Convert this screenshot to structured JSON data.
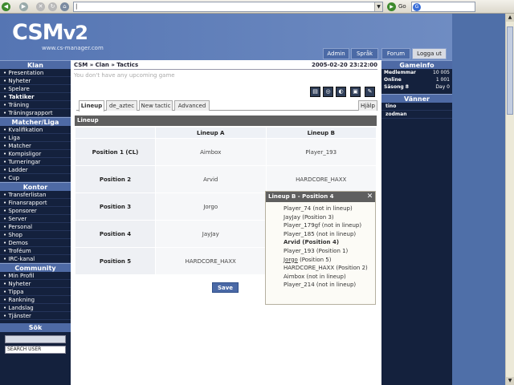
{
  "browser": {
    "url": "|",
    "go_label": "Go"
  },
  "logo": {
    "main": "CSM",
    "version": "v2",
    "sub": "www.cs-manager.com"
  },
  "topnav": [
    "Admin",
    "Språk",
    "Forum",
    "Logga ut"
  ],
  "leftnav": {
    "sections": [
      {
        "title": "Klan",
        "items": [
          "Presentation",
          "Nyheter",
          "Spelare",
          "Taktiker",
          "Träning",
          "Träningsrapport"
        ]
      },
      {
        "title": "Matcher/Liga",
        "items": [
          "Kvalifikation",
          "Liga",
          "Matcher",
          "Kompisligor",
          "Turneringar",
          "Ladder",
          "Cup"
        ]
      },
      {
        "title": "Kontor",
        "items": [
          "Transferlistan",
          "Finansrapport",
          "Sponsorer",
          "Server",
          "Personal",
          "Shop",
          "Demos",
          "Troféum",
          "IRC-kanal"
        ]
      },
      {
        "title": "Community",
        "items": [
          "Min Profil",
          "Nyheter",
          "Tippa",
          "Rankning",
          "Landslag",
          "Tjänster"
        ]
      }
    ],
    "active_item": "Taktiker",
    "search_title": "Sök",
    "search_select": "SEARCH USER"
  },
  "main": {
    "breadcrumb": "CSM » Clan » Tactics",
    "datetime": "2005-02-20 23:22:00",
    "notice": "You don't have any upcoming game",
    "tabs": [
      "Lineup",
      "de_aztec",
      "New tactic",
      "Advanced"
    ],
    "help": "Hjälp",
    "section_title": "Lineup",
    "col_a": "Lineup A",
    "col_b": "Lineup B",
    "rows": [
      {
        "position": "Position 1 (CL)",
        "a": "Aimbox",
        "b": "Player_193"
      },
      {
        "position": "Position 2",
        "a": "Arvid",
        "b": "HARDCORE_HAXX"
      },
      {
        "position": "Position 3",
        "a": "Jorgo",
        "b": ""
      },
      {
        "position": "Position 4",
        "a": "JayJay",
        "b": ""
      },
      {
        "position": "Position 5",
        "a": "HARDCORE_HAXX",
        "b": ""
      }
    ],
    "save_label": "Save"
  },
  "popup": {
    "title": "Lineup B - Position 4",
    "items": [
      {
        "name": "Player_74",
        "note": "(not in lineup)"
      },
      {
        "name": "JayJay",
        "note": "(Position 3)"
      },
      {
        "name": "Player_179gf",
        "note": "(not in lineup)"
      },
      {
        "name": "Player_185",
        "note": "(not in lineup)"
      },
      {
        "name": "Arvid",
        "note": "(Position 4)"
      },
      {
        "name": "Player_193",
        "note": "(Position 1)"
      },
      {
        "name": "Jorgo",
        "note": "(Position 5)"
      },
      {
        "name": "HARDCORE_HAXX",
        "note": "(Position 2)"
      },
      {
        "name": "Aimbox",
        "note": "(not in lineup)"
      },
      {
        "name": "Player_214",
        "note": "(not in lineup)"
      }
    ]
  },
  "gameinfo": {
    "title": "Gameinfo",
    "rows": [
      {
        "label": "Medlemmar",
        "value": "10 005"
      },
      {
        "label": "Online",
        "value": "1 001"
      },
      {
        "label": "Säsong 8",
        "value": "Day 0"
      }
    ]
  },
  "friends": {
    "title": "Vänner",
    "items": [
      "tino",
      "zodman"
    ]
  }
}
